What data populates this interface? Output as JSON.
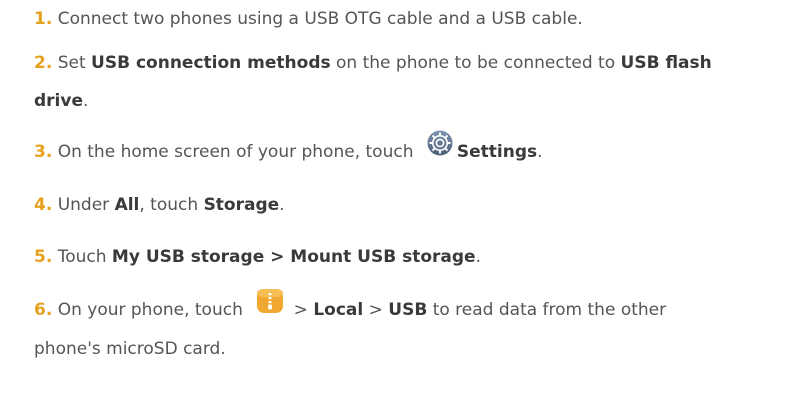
{
  "steps": [
    {
      "num": "1.",
      "text": " Connect two phones using a USB OTG cable and a USB cable."
    },
    {
      "num": "2.",
      "t1": " Set ",
      "b1": "USB connection methods",
      "t2": " on the phone to be connected to ",
      "b2": "USB flash",
      "b3": "drive",
      "t3": "."
    },
    {
      "num": "3.",
      "t1": " On the home screen of your phone, touch ",
      "icon": "settings-gear-icon",
      "b1": "Settings",
      "t2": "."
    },
    {
      "num": "4.",
      "t1": " Under ",
      "b1": "All",
      "t2": ", touch ",
      "b2": "Storage",
      "t3": "."
    },
    {
      "num": "5.",
      "t1": " Touch ",
      "b1": "My USB storage > Mount USB storage",
      "t2": "."
    },
    {
      "num": "6.",
      "t1": " On your phone, touch ",
      "icon": "file-manager-icon",
      "sep1": " > ",
      "b1": "Local",
      "sep2": " > ",
      "b2": "USB",
      "t2": " to read data from the other",
      "t3": "phone's microSD card."
    }
  ],
  "colors": {
    "number": "#e6a21e",
    "text": "#555555",
    "bold": "#3a3a3a",
    "settings_icon": "#5a6e8a",
    "file_icon": "#f0a830"
  }
}
